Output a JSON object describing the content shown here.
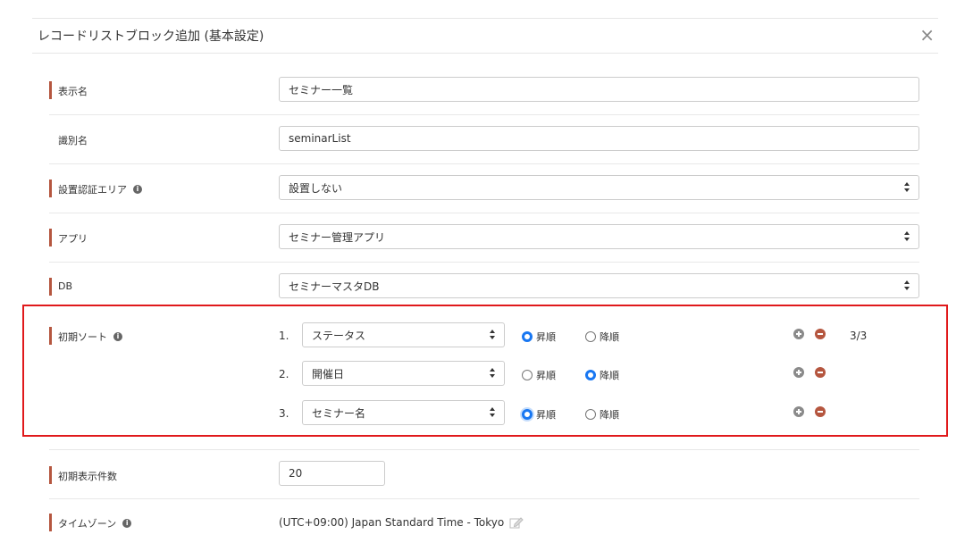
{
  "modal": {
    "title": "レコードリストブロック追加 (基本設定)",
    "close_label": "×"
  },
  "fields": {
    "display_name": {
      "label": "表示名",
      "value": "セミナー一覧"
    },
    "identifier": {
      "label": "識別名",
      "value": "seminarList"
    },
    "auth_area": {
      "label": "設置認証エリア",
      "value": "設置しない"
    },
    "app": {
      "label": "アプリ",
      "value": "セミナー管理アプリ"
    },
    "db": {
      "label": "DB",
      "value": "セミナーマスタDB"
    },
    "initial_count": {
      "label": "初期表示件数",
      "value": "20"
    },
    "timezone": {
      "label": "タイムゾーン",
      "value": "(UTC+09:00) Japan Standard Time - Tokyo"
    }
  },
  "sort": {
    "label": "初期ソート",
    "count": "3/3",
    "asc_label": "昇順",
    "desc_label": "降順",
    "rules": [
      {
        "num": "1.",
        "field": "ステータス",
        "order": "asc"
      },
      {
        "num": "2.",
        "field": "開催日",
        "order": "desc"
      },
      {
        "num": "3.",
        "field": "セミナー名",
        "order": "asc"
      }
    ]
  },
  "colors": {
    "required_bar": "#b5563f",
    "radio_active": "#1877f2",
    "highlight_border": "#e0191b"
  },
  "icons": [
    "info-icon",
    "plus-icon",
    "minus-icon",
    "edit-icon",
    "close-icon",
    "select-arrow-icon"
  ]
}
